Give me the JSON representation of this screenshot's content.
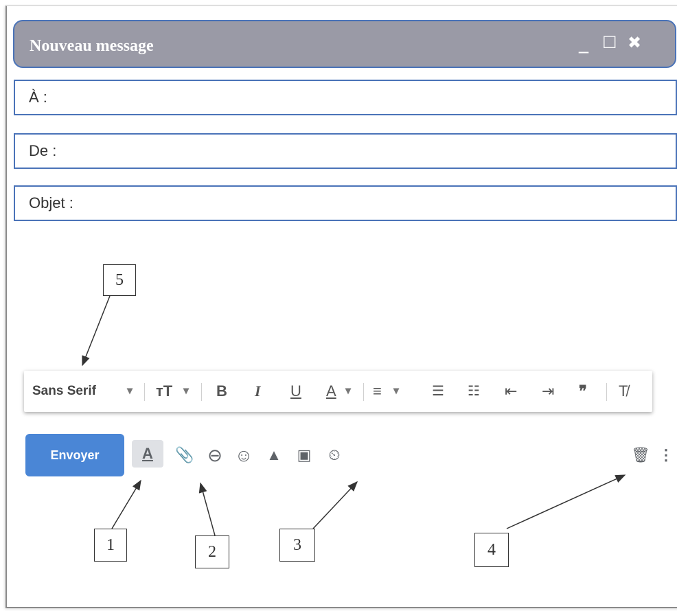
{
  "window": {
    "title": "Nouveau message",
    "controls": {
      "minimize": "_",
      "maximize": "☐",
      "close": "✖"
    }
  },
  "fields": {
    "to_label": "À :",
    "from_label": "De :",
    "subject_label": "Objet :"
  },
  "format_toolbar": {
    "font_name": "Sans Serif",
    "font_dropdown": "▾",
    "size_icon": "ᴛT",
    "bold": "B",
    "italic": "I",
    "underline": "U",
    "text_color": "A",
    "align_icon": "≡",
    "numbered_list_icon": "☰",
    "bullet_list_icon": "☷",
    "indent_less_icon": "⇤",
    "indent_more_icon": "⇥",
    "quote_icon": "❞",
    "clear_format_icon": "T̸"
  },
  "actions": {
    "send_label": "Envoyer",
    "formatting_icon": "A",
    "attach_icon": "📎",
    "link_icon": "⊖",
    "emoji_icon": "☺",
    "drive_icon": "▲",
    "photo_icon": "▣",
    "confidential_icon": "⏲",
    "delete_icon": "🗑",
    "more_icon": "⋮"
  },
  "annotations": [
    "1",
    "2",
    "3",
    "4",
    "5"
  ]
}
